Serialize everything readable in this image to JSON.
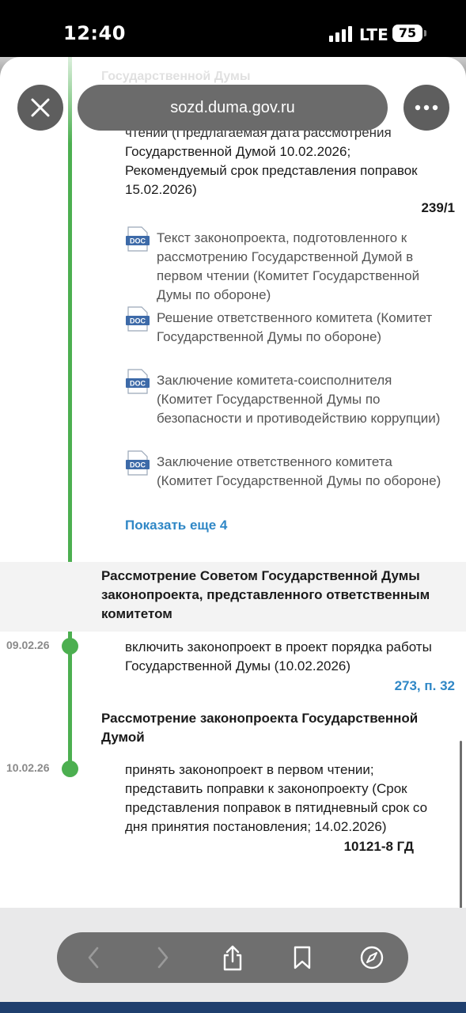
{
  "status_bar": {
    "time": "12:40",
    "network": "LTE",
    "battery": "75"
  },
  "browser": {
    "url": "sozd.duma.gov.ru",
    "close_icon": "close-icon",
    "more_icon": "more-icon",
    "toolbar": [
      "back-icon",
      "forward-icon",
      "share-icon",
      "bookmarks-icon",
      "compass-icon"
    ]
  },
  "page": {
    "peek_heading": "Государственной Думы",
    "entry1": {
      "text_lines": [
        "чтении (Предлагаемая дата рассмотрения",
        "Государственной Думой 10.02.2026;",
        "Рекомендуемый срок представления поправок",
        "15.02.2026)"
      ],
      "ref": "239/1"
    },
    "documents": [
      {
        "type": "DOC",
        "label": "Текст законопроекта, подготовленного к рассмотрению Государственной Думой в первом чтении (Комитет Государственной Думы по обороне)"
      },
      {
        "type": "DOC",
        "label": "Решение ответственного комитета (Комитет Государственной Думы по обороне)"
      },
      {
        "type": "DOC",
        "label": "Заключение комитета-соисполнителя (Комитет Государственной Думы по безопасности и противодействию коррупции)"
      },
      {
        "type": "DOC",
        "label": "Заключение ответственного комитета (Комитет Государственной Думы по обороне)"
      }
    ],
    "show_more": "Показать еще 4",
    "section1": {
      "title_lines": [
        "Рассмотрение Советом Государственной Думы",
        "законопроекта, представленного ответственным",
        "комитетом"
      ],
      "date": "09.02.26",
      "text_lines": [
        "включить законопроект в проект порядка работы",
        "Государственной Думы (10.02.2026)"
      ],
      "ref": "273, п. 32"
    },
    "section2": {
      "title_lines": [
        "Рассмотрение законопроекта Государственной",
        "Думой"
      ],
      "date": "10.02.26",
      "text_lines": [
        "принять законопроект в первом чтении;",
        "представить поправки к законопроекту (Срок",
        "представления поправок в пятидневный срок со",
        "дня принятия постановления; 14.02.2026)"
      ],
      "ref": "10121-8 ГД"
    }
  },
  "colors": {
    "timeline": "#4caf50",
    "link": "#2f87c6",
    "doc_icon": "#3d6aa8"
  }
}
